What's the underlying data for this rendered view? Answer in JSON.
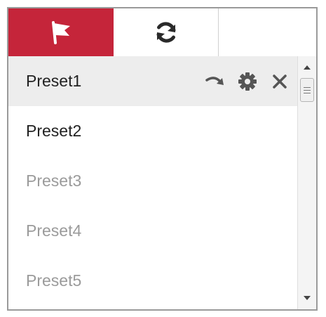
{
  "tabs": [
    {
      "icon": "flag-icon",
      "active": true
    },
    {
      "icon": "refresh-icon",
      "active": false
    },
    {
      "icon": "",
      "active": false
    }
  ],
  "presets": [
    {
      "label": "Preset1",
      "selected": true,
      "set": true
    },
    {
      "label": "Preset2",
      "selected": false,
      "set": true
    },
    {
      "label": "Preset3",
      "selected": false,
      "set": false
    },
    {
      "label": "Preset4",
      "selected": false,
      "set": false
    },
    {
      "label": "Preset5",
      "selected": false,
      "set": false
    }
  ],
  "row_actions": [
    "call-preset-icon",
    "gear-icon",
    "close-icon"
  ],
  "colors": {
    "active_tab": "#c5253a",
    "selected_row": "#ededed",
    "set_text": "#222222",
    "unset_text": "#9b9b9b"
  }
}
